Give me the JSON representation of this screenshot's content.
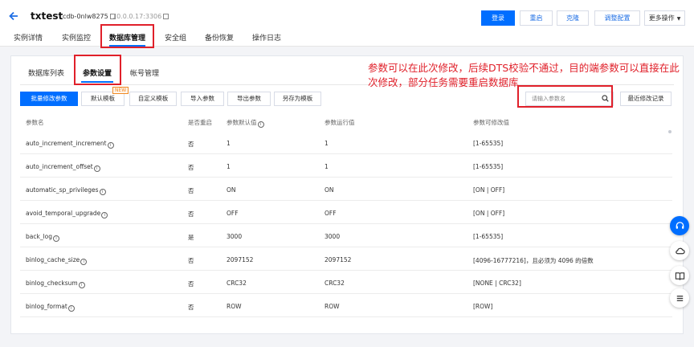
{
  "header": {
    "title": "txtest",
    "instance_id": "cdb-0nlw8275",
    "ip": "10.0.0.17:3306",
    "buttons": {
      "login": "登录",
      "restart": "重启",
      "clone": "克隆",
      "resize": "调整配置",
      "more": "更多操作"
    }
  },
  "main_tabs": [
    "实例详情",
    "实例监控",
    "数据库管理",
    "安全组",
    "备份恢复",
    "操作日志"
  ],
  "sub_tabs": [
    "数据库列表",
    "参数设置",
    "帐号管理"
  ],
  "annotation": "参数可以在此次修改，后续DTS校验不通过，目的端参数可以直接在此次修改，部分任务需要重启数据库",
  "toolbar": {
    "batch_modify": "批量修改参数",
    "default_template": "默认模板",
    "new_badge": "NEW",
    "custom_template": "自定义模板",
    "import": "导入参数",
    "export": "导出参数",
    "save_as_template": "另存为模板",
    "recent_changes": "最近修改记录"
  },
  "search": {
    "placeholder": "请输入参数名"
  },
  "table": {
    "headers": {
      "name": "参数名",
      "restart": "是否重启",
      "default": "参数默认值",
      "running": "参数运行值",
      "range": "参数可修改值"
    },
    "rows": [
      {
        "name": "auto_increment_increment",
        "restart": "否",
        "default": "1",
        "running": "1",
        "range": "[1-65535]"
      },
      {
        "name": "auto_increment_offset",
        "restart": "否",
        "default": "1",
        "running": "1",
        "range": "[1-65535]"
      },
      {
        "name": "automatic_sp_privileges",
        "restart": "否",
        "default": "ON",
        "running": "ON",
        "range": "[ON | OFF]"
      },
      {
        "name": "avoid_temporal_upgrade",
        "restart": "否",
        "default": "OFF",
        "running": "OFF",
        "range": "[ON | OFF]"
      },
      {
        "name": "back_log",
        "restart": "是",
        "default": "3000",
        "running": "3000",
        "range": "[1-65535]"
      },
      {
        "name": "binlog_cache_size",
        "restart": "否",
        "default": "2097152",
        "running": "2097152",
        "range": "[4096-16777216]，且必须为 4096 的倍数"
      },
      {
        "name": "binlog_checksum",
        "restart": "否",
        "default": "CRC32",
        "running": "CRC32",
        "range": "[NONE | CRC32]"
      },
      {
        "name": "binlog_format",
        "restart": "否",
        "default": "ROW",
        "running": "ROW",
        "range": "[ROW]"
      }
    ]
  },
  "colors": {
    "primary": "#006eff",
    "annotation_red": "#e0202a"
  }
}
